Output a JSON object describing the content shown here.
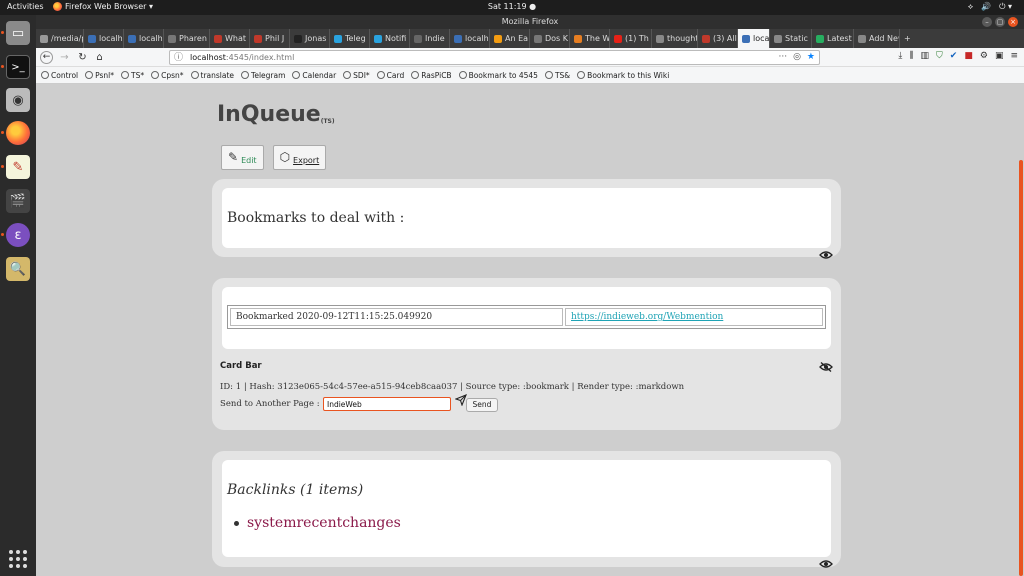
{
  "topbar": {
    "activities": "Activities",
    "app_menu": "Firefox Web Browser ▾",
    "clock": "Sat 11:19 ●",
    "tray": [
      "⟡",
      "🔊",
      "⏻ ▾"
    ]
  },
  "window": {
    "title": "Mozilla Firefox"
  },
  "tabs": [
    {
      "label": "/media/pi",
      "color": "#999"
    },
    {
      "label": "localh",
      "color": "#3b6fb6"
    },
    {
      "label": "localh",
      "color": "#3b6fb6"
    },
    {
      "label": "Pharen Tu",
      "color": "#777"
    },
    {
      "label": "What",
      "color": "#c0392b"
    },
    {
      "label": "Phil J",
      "color": "#c0392b"
    },
    {
      "label": "Jonas",
      "color": "#222"
    },
    {
      "label": "Teleg",
      "color": "#2aa3df"
    },
    {
      "label": "Notifi",
      "color": "#2aa3df"
    },
    {
      "label": "Indie",
      "color": "#666"
    },
    {
      "label": "localh",
      "color": "#3b6fb6"
    },
    {
      "label": "An Ea",
      "color": "#f39c12"
    },
    {
      "label": "Dos K",
      "color": "#777"
    },
    {
      "label": "The W",
      "color": "#e67e22"
    },
    {
      "label": "(1) Th",
      "color": "#e62117"
    },
    {
      "label": "thoughts",
      "color": "#888"
    },
    {
      "label": "(3) All",
      "color": "#c0392b"
    },
    {
      "label": "loca",
      "color": "#3b6fb6",
      "active": true
    },
    {
      "label": "Static",
      "color": "#888"
    },
    {
      "label": "Latest",
      "color": "#27ae60"
    },
    {
      "label": "Add New",
      "color": "#888"
    }
  ],
  "navbar": {
    "url_host": "localhost",
    "url_path": ":4545/index.html",
    "url_right": "···"
  },
  "bookmarks": [
    "Control",
    "Psnl*",
    "TS*",
    "Cpsn*",
    "translate",
    "Telegram",
    "Calendar",
    "SDI*",
    "Card",
    "RasPiCB",
    "Bookmark to 4545",
    "TS&",
    "Bookmark to this Wiki"
  ],
  "page": {
    "title": "InQueue",
    "title_sub": "(TS)",
    "edit_label": "Edit",
    "export_label": "Export",
    "card1_heading": "Bookmarks to deal with :",
    "bookmark_time": "Bookmarked 2020-09-12T11:15:25.049920",
    "bookmark_url": "https://indieweb.org/Webmention",
    "card_bar": "Card Bar",
    "meta": "ID: 1 | Hash: 3123e065-54c4-57ee-a515-94ceb8caa037 | Source type: :bookmark | Render type: :markdown",
    "send_label": "Send to Another Page :",
    "send_value": "IndieWeb",
    "send_button": "Send",
    "backlinks_heading": "Backlinks (1 items)",
    "backlinks": [
      "systemrecentchanges"
    ]
  }
}
